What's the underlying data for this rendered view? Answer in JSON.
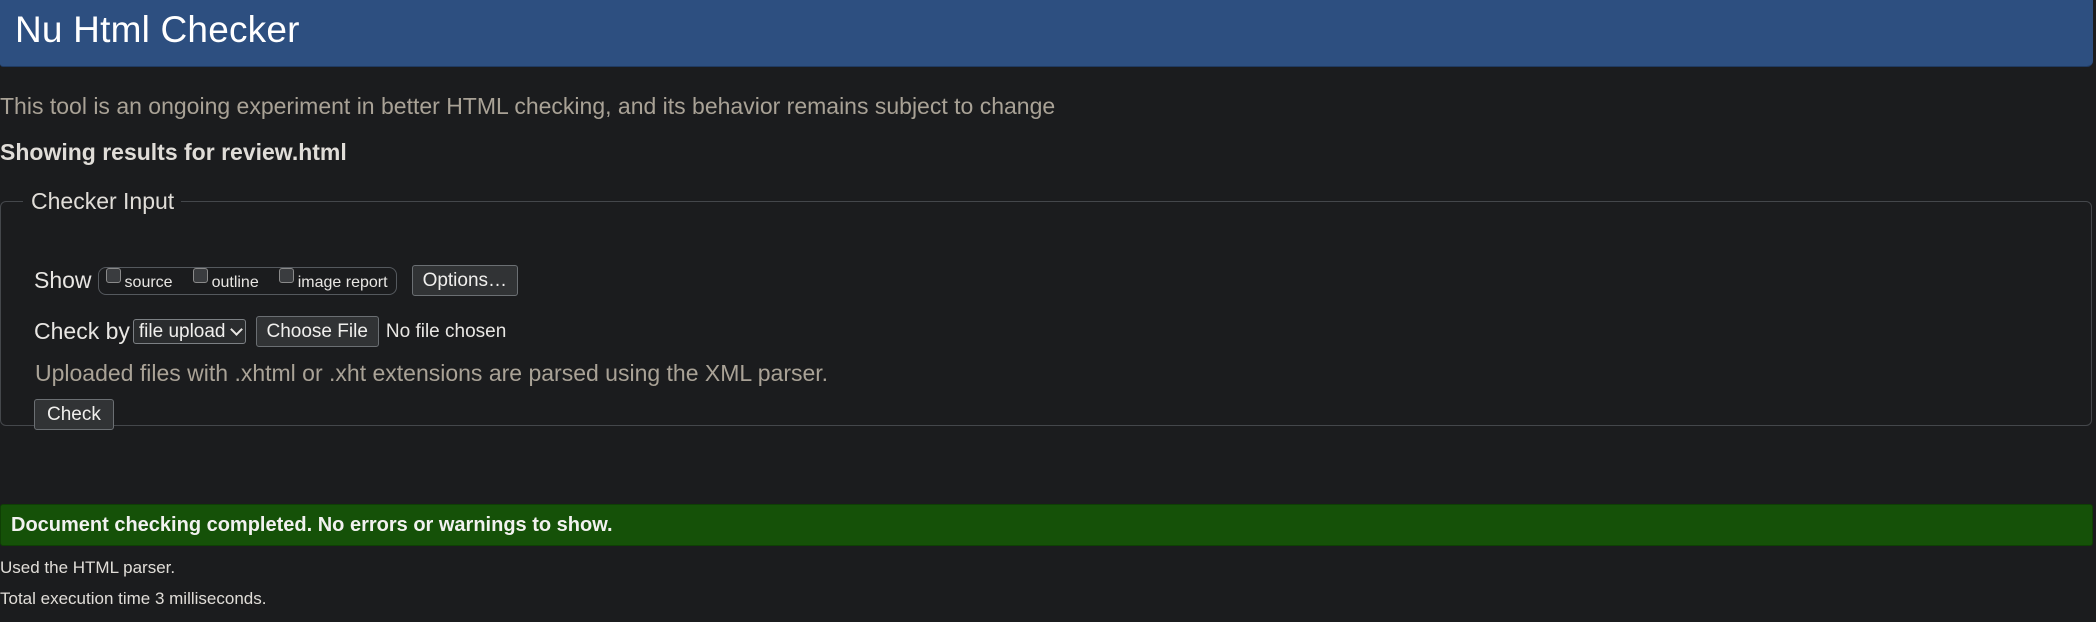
{
  "header": {
    "title": "Nu Html Checker"
  },
  "tagline": "This tool is an ongoing experiment in better HTML checking, and its behavior remains subject to change",
  "results_heading": "Showing results for review.html",
  "checker_input": {
    "legend": "Checker Input",
    "show_label": "Show",
    "show_options": [
      {
        "label": "source",
        "checked": false
      },
      {
        "label": "outline",
        "checked": false
      },
      {
        "label": "image report",
        "checked": false
      }
    ],
    "options_button": "Options…",
    "check_by_label": "Check by",
    "check_by_selected": "file upload",
    "choose_file_button": "Choose File",
    "file_status": "No file chosen",
    "xml_note": "Uploaded files with .xhtml or .xht extensions are parsed using the XML parser.",
    "check_button": "Check"
  },
  "result": {
    "success_message": "Document checking completed. No errors or warnings to show.",
    "parser_info": "Used the HTML parser.",
    "time_info": "Total execution time 3 milliseconds."
  },
  "colors": {
    "header_bg": "#2d4f80",
    "page_bg": "#1b1c1e",
    "success_bg": "#155108",
    "muted_text": "#a9a296"
  }
}
